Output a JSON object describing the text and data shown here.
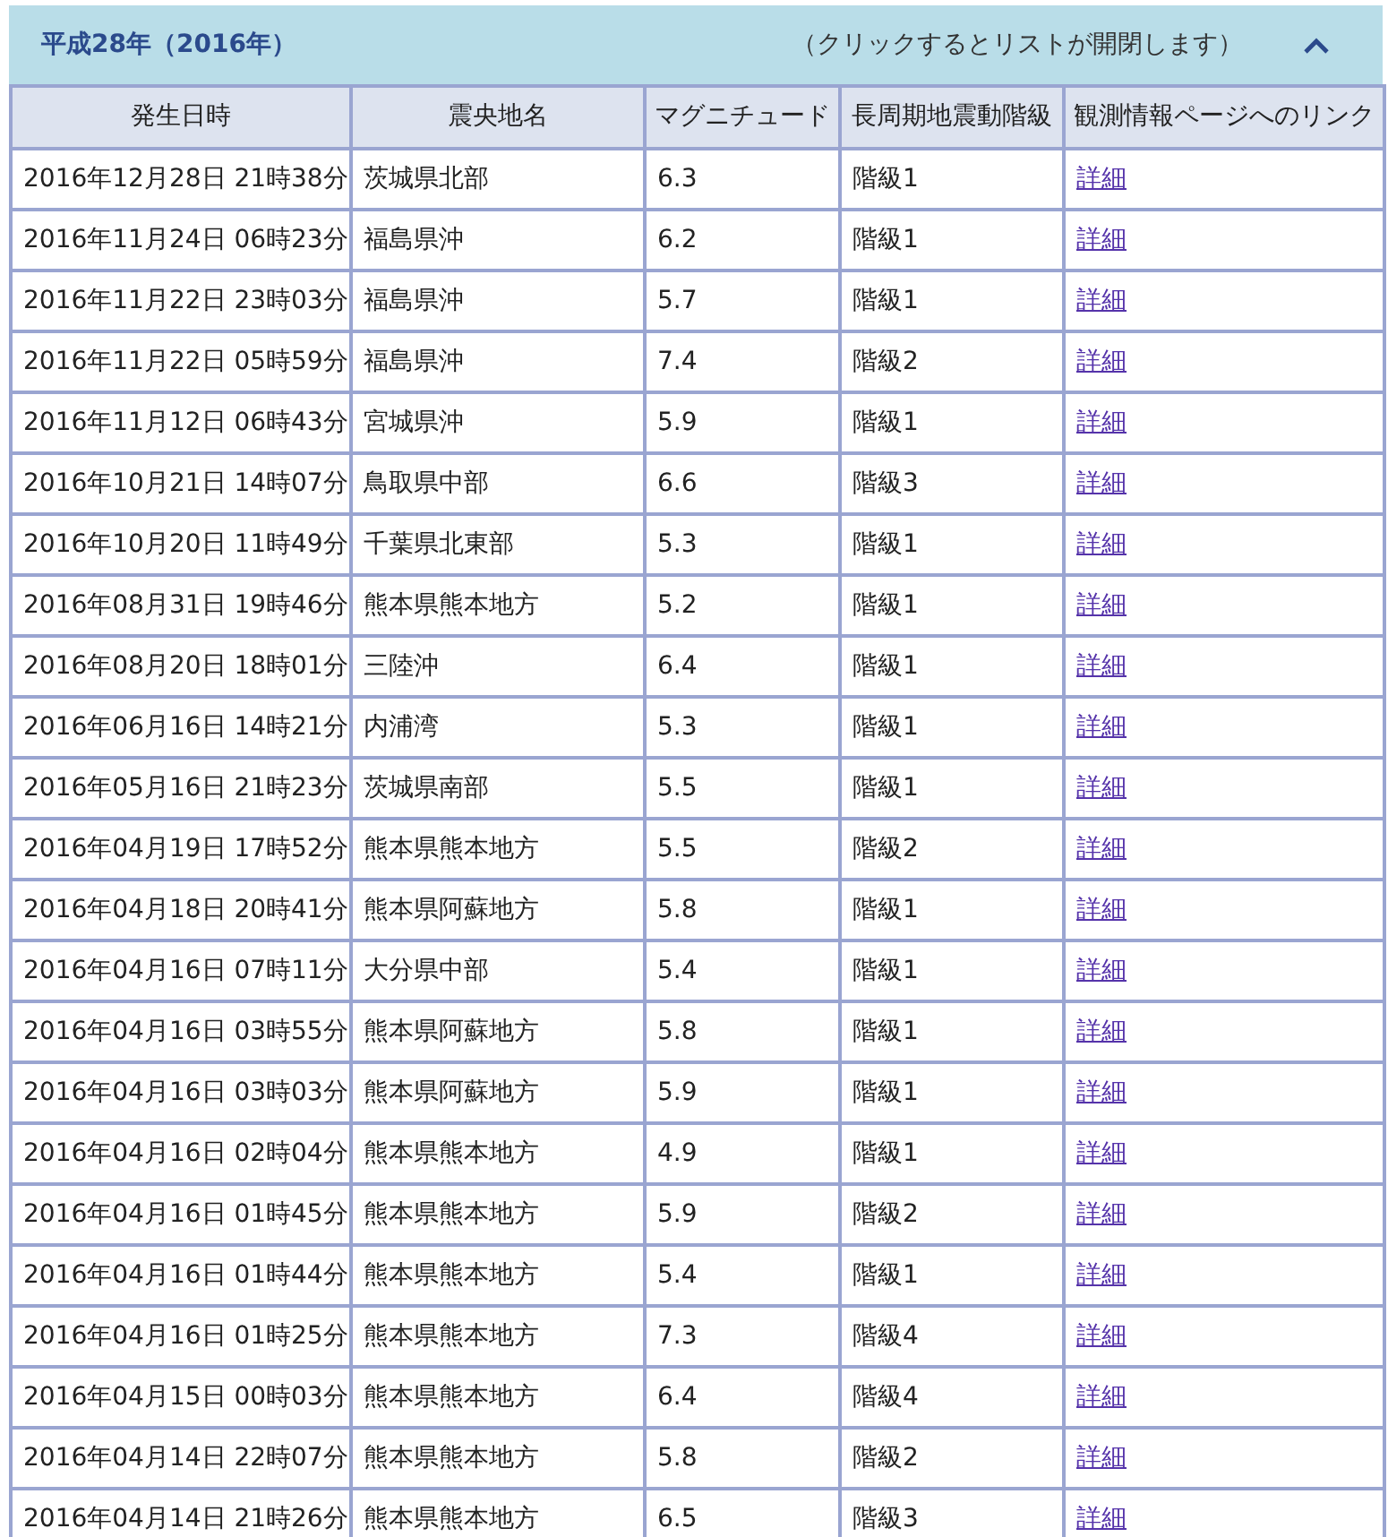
{
  "section": {
    "title": "平成28年（2016年）",
    "hint": "（クリックするとリストが開閉します）",
    "expanded": true
  },
  "table": {
    "columns": [
      "発生日時",
      "震央地名",
      "マグニチュード",
      "長周期地震動階級",
      "観測情報ページへのリンク"
    ],
    "rows": [
      [
        "2016年12月28日 21時38分",
        "茨城県北部",
        "6.3",
        "階級1",
        "詳細"
      ],
      [
        "2016年11月24日 06時23分",
        "福島県沖",
        "6.2",
        "階級1",
        "詳細"
      ],
      [
        "2016年11月22日 23時03分",
        "福島県沖",
        "5.7",
        "階級1",
        "詳細"
      ],
      [
        "2016年11月22日 05時59分",
        "福島県沖",
        "7.4",
        "階級2",
        "詳細"
      ],
      [
        "2016年11月12日 06時43分",
        "宮城県沖",
        "5.9",
        "階級1",
        "詳細"
      ],
      [
        "2016年10月21日 14時07分",
        "鳥取県中部",
        "6.6",
        "階級3",
        "詳細"
      ],
      [
        "2016年10月20日 11時49分",
        "千葉県北東部",
        "5.3",
        "階級1",
        "詳細"
      ],
      [
        "2016年08月31日 19時46分",
        "熊本県熊本地方",
        "5.2",
        "階級1",
        "詳細"
      ],
      [
        "2016年08月20日 18時01分",
        "三陸沖",
        "6.4",
        "階級1",
        "詳細"
      ],
      [
        "2016年06月16日 14時21分",
        "内浦湾",
        "5.3",
        "階級1",
        "詳細"
      ],
      [
        "2016年05月16日 21時23分",
        "茨城県南部",
        "5.5",
        "階級1",
        "詳細"
      ],
      [
        "2016年04月19日 17時52分",
        "熊本県熊本地方",
        "5.5",
        "階級2",
        "詳細"
      ],
      [
        "2016年04月18日 20時41分",
        "熊本県阿蘇地方",
        "5.8",
        "階級1",
        "詳細"
      ],
      [
        "2016年04月16日 07時11分",
        "大分県中部",
        "5.4",
        "階級1",
        "詳細"
      ],
      [
        "2016年04月16日 03時55分",
        "熊本県阿蘇地方",
        "5.8",
        "階級1",
        "詳細"
      ],
      [
        "2016年04月16日 03時03分",
        "熊本県阿蘇地方",
        "5.9",
        "階級1",
        "詳細"
      ],
      [
        "2016年04月16日 02時04分",
        "熊本県熊本地方",
        "4.9",
        "階級1",
        "詳細"
      ],
      [
        "2016年04月16日 01時45分",
        "熊本県熊本地方",
        "5.9",
        "階級2",
        "詳細"
      ],
      [
        "2016年04月16日 01時44分",
        "熊本県熊本地方",
        "5.4",
        "階級1",
        "詳細"
      ],
      [
        "2016年04月16日 01時25分",
        "熊本県熊本地方",
        "7.3",
        "階級4",
        "詳細"
      ],
      [
        "2016年04月15日 00時03分",
        "熊本県熊本地方",
        "6.4",
        "階級4",
        "詳細"
      ],
      [
        "2016年04月14日 22時07分",
        "熊本県熊本地方",
        "5.8",
        "階級2",
        "詳細"
      ],
      [
        "2016年04月14日 21時26分",
        "熊本県熊本地方",
        "6.5",
        "階級3",
        "詳細"
      ]
    ]
  }
}
